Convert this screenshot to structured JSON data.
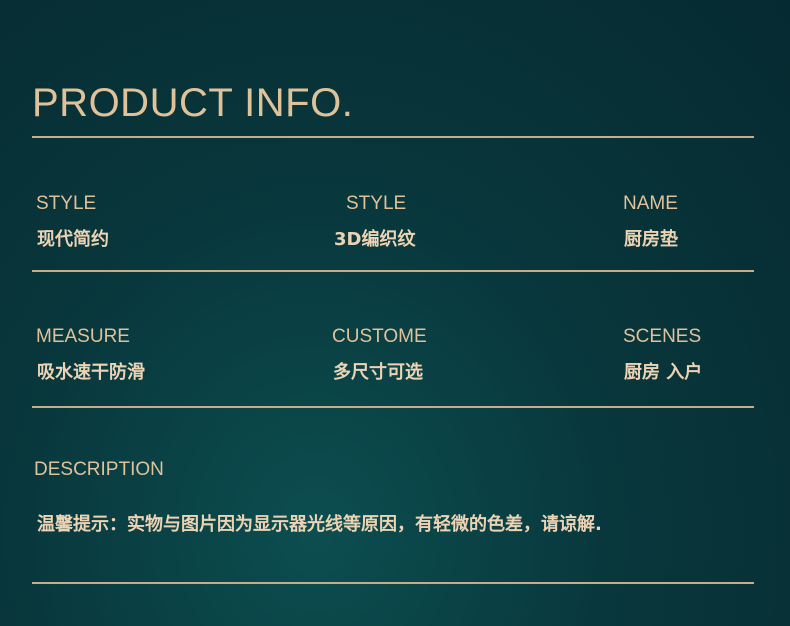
{
  "title": "PRODUCT INFO.",
  "specs": {
    "style1": {
      "label": "STYLE",
      "value": "现代简约"
    },
    "style2": {
      "label": "STYLE",
      "value": "3D编织纹"
    },
    "name": {
      "label": "NAME",
      "value": "厨房垫"
    },
    "measure": {
      "label": "MEASURE",
      "value": "吸水速干防滑"
    },
    "custome": {
      "label": "CUSTOME",
      "value": "多尺寸可选"
    },
    "scenes": {
      "label": "SCENES",
      "value": "厨房 入户"
    }
  },
  "description": {
    "label": "DESCRIPTION",
    "text": "温馨提示：实物与图片因为显示器光线等原因，有轻微的色差，请谅解."
  },
  "colors": {
    "accent": "#e0c29a",
    "rule": "#c8ab87",
    "background": "#08373c"
  }
}
